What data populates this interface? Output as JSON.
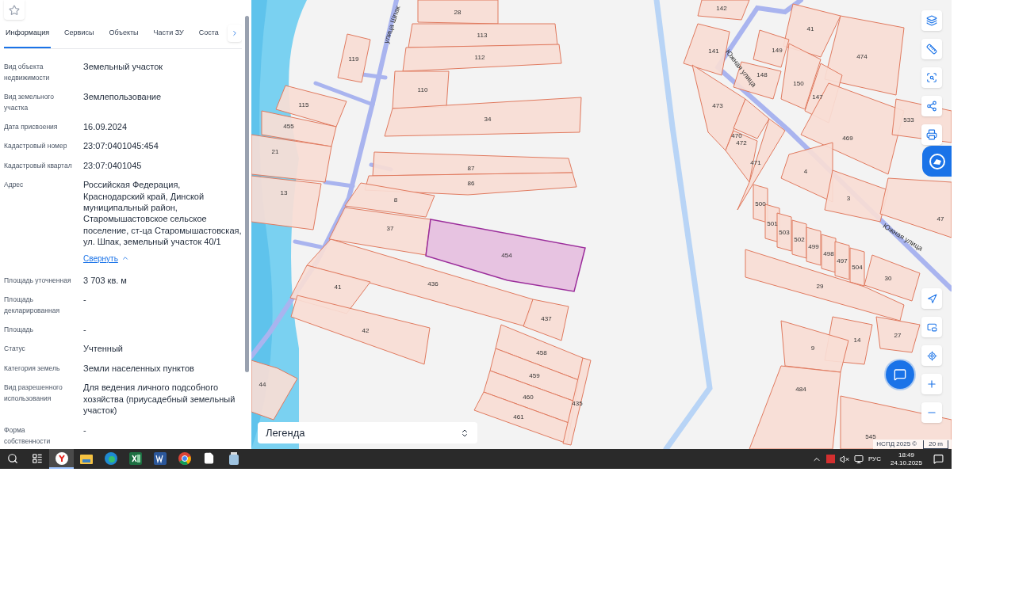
{
  "sidebar": {
    "tabs": [
      {
        "label": "Информация",
        "selected": true
      },
      {
        "label": "Сервисы",
        "selected": false
      },
      {
        "label": "Объекты",
        "selected": false
      },
      {
        "label": "Части ЗУ",
        "selected": false
      },
      {
        "label": "Соста",
        "selected": false
      }
    ],
    "rows": [
      {
        "label": "Вид объекта недвижимости",
        "value": "Земельный участок"
      },
      {
        "label": "Вид земельного участка",
        "value": "Землепользование"
      },
      {
        "label": "Дата присвоения",
        "value": "16.09.2024"
      },
      {
        "label": "Кадастровый номер",
        "value": "23:07:0401045:454"
      },
      {
        "label": "Кадастровый квартал",
        "value": "23:07:0401045"
      },
      {
        "label": "Адрес",
        "value": "Российская Федерация, Краснодарский край, Динской муниципальный район, Старомышастовское сельское поселение, ст-ца Старомышастовская, ул. Шпак, земельный участок 40/1",
        "link": "Свернуть"
      },
      {
        "label": "Площадь уточненная",
        "value": "3 703 кв. м"
      },
      {
        "label": "Площадь декларированная",
        "value": "-"
      },
      {
        "label": "Площадь",
        "value": "-"
      },
      {
        "label": "Статус",
        "value": "Учтенный"
      },
      {
        "label": "Категория земель",
        "value": "Земли населенных пунктов"
      },
      {
        "label": "Вид разрешенного использования",
        "value": "Для ведения личного подсобного хозяйства (приусадебный земельный участок)"
      },
      {
        "label": "Форма собственности",
        "value": "-"
      }
    ]
  },
  "map": {
    "parcels": [
      {
        "label": "28",
        "selected": false
      },
      {
        "label": "113",
        "selected": false
      },
      {
        "label": "112",
        "selected": false
      },
      {
        "label": "119",
        "selected": false
      },
      {
        "label": "110",
        "selected": false
      },
      {
        "label": "34",
        "selected": false
      },
      {
        "label": "115",
        "selected": false
      },
      {
        "label": "455",
        "selected": false
      },
      {
        "label": "21",
        "selected": false
      },
      {
        "label": "13",
        "selected": false
      },
      {
        "label": "87",
        "selected": false
      },
      {
        "label": "86",
        "selected": false
      },
      {
        "label": "8",
        "selected": false
      },
      {
        "label": "37",
        "selected": false
      },
      {
        "label": "454",
        "selected": true
      },
      {
        "label": "436",
        "selected": false
      },
      {
        "label": "41",
        "selected": false
      },
      {
        "label": "437",
        "selected": false
      },
      {
        "label": "42",
        "selected": false
      },
      {
        "label": "458",
        "selected": false
      },
      {
        "label": "459",
        "selected": false
      },
      {
        "label": "460",
        "selected": false
      },
      {
        "label": "461",
        "selected": false
      },
      {
        "label": "435",
        "selected": false
      },
      {
        "label": "44",
        "selected": false
      },
      {
        "label": "142",
        "selected": false
      },
      {
        "label": "141",
        "selected": false
      },
      {
        "label": "41",
        "selected": false
      },
      {
        "label": "149",
        "selected": false
      },
      {
        "label": "474",
        "selected": false
      },
      {
        "label": "148",
        "selected": false
      },
      {
        "label": "150",
        "selected": false
      },
      {
        "label": "147",
        "selected": false
      },
      {
        "label": "473",
        "selected": false
      },
      {
        "label": "470",
        "selected": false
      },
      {
        "label": "472",
        "selected": false
      },
      {
        "label": "471",
        "selected": false
      },
      {
        "label": "469",
        "selected": false
      },
      {
        "label": "533",
        "selected": false
      },
      {
        "label": "4",
        "selected": false
      },
      {
        "label": "3",
        "selected": false
      },
      {
        "label": "47",
        "selected": false
      },
      {
        "label": "500",
        "selected": false
      },
      {
        "label": "501",
        "selected": false
      },
      {
        "label": "503",
        "selected": false
      },
      {
        "label": "502",
        "selected": false
      },
      {
        "label": "499",
        "selected": false
      },
      {
        "label": "498",
        "selected": false
      },
      {
        "label": "497",
        "selected": false
      },
      {
        "label": "504",
        "selected": false
      },
      {
        "label": "30",
        "selected": false
      },
      {
        "label": "29",
        "selected": false
      },
      {
        "label": "27",
        "selected": false
      },
      {
        "label": "14",
        "selected": false
      },
      {
        "label": "9",
        "selected": false
      },
      {
        "label": "484",
        "selected": false
      },
      {
        "label": "545",
        "selected": false
      }
    ],
    "streets": [
      "улица Шпак",
      "Южная улица",
      "Южная улица"
    ],
    "legend": "Легенда",
    "attribution": "НСПД 2025 ©",
    "scale": "20 m"
  },
  "taskbar": {
    "apps": [
      {
        "kind": "search",
        "selected": false
      },
      {
        "kind": "taskview",
        "selected": false
      },
      {
        "kind": "yandex",
        "selected": true
      },
      {
        "kind": "explorer",
        "selected": false
      },
      {
        "kind": "edge",
        "selected": false
      },
      {
        "kind": "excel",
        "selected": false
      },
      {
        "kind": "word",
        "selected": false
      },
      {
        "kind": "chrome",
        "selected": false
      },
      {
        "kind": "file",
        "selected": false
      },
      {
        "kind": "app",
        "selected": false
      }
    ],
    "tray": {
      "language": "РУС",
      "time": "18:49",
      "date": "24.10.2025"
    }
  }
}
